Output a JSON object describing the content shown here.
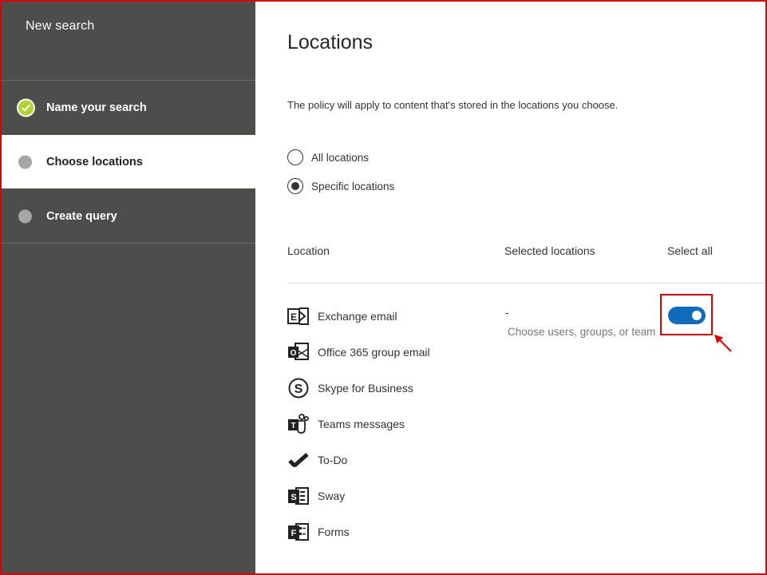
{
  "sidebar": {
    "title": "New search",
    "steps": [
      {
        "label": "Name your search",
        "state": "completed"
      },
      {
        "label": "Choose locations",
        "state": "current"
      },
      {
        "label": "Create query",
        "state": "pending"
      }
    ]
  },
  "main": {
    "title": "Locations",
    "description": "The policy will apply to content that's stored in the locations you choose.",
    "radio_options": [
      {
        "label": "All locations",
        "checked": false
      },
      {
        "label": "Specific locations",
        "checked": true
      }
    ],
    "table": {
      "headers": {
        "location": "Location",
        "selected": "Selected locations",
        "select_all": "Select all"
      },
      "selected_value": "-",
      "selected_hint": "Choose users, groups, or teams",
      "select_all_toggle": "on",
      "locations": [
        {
          "label": "Exchange email",
          "icon": "exchange-icon"
        },
        {
          "label": "Office 365 group email",
          "icon": "outlook-group-icon"
        },
        {
          "label": "Skype for Business",
          "icon": "skype-icon"
        },
        {
          "label": "Teams messages",
          "icon": "teams-icon"
        },
        {
          "label": "To-Do",
          "icon": "todo-icon"
        },
        {
          "label": "Sway",
          "icon": "sway-icon"
        },
        {
          "label": "Forms",
          "icon": "forms-icon"
        }
      ]
    }
  },
  "colors": {
    "sidebar_bg": "#4d4d4c",
    "check_green": "#b0d330",
    "toggle_blue": "#0f6cbd",
    "highlight_red": "#e00000"
  }
}
